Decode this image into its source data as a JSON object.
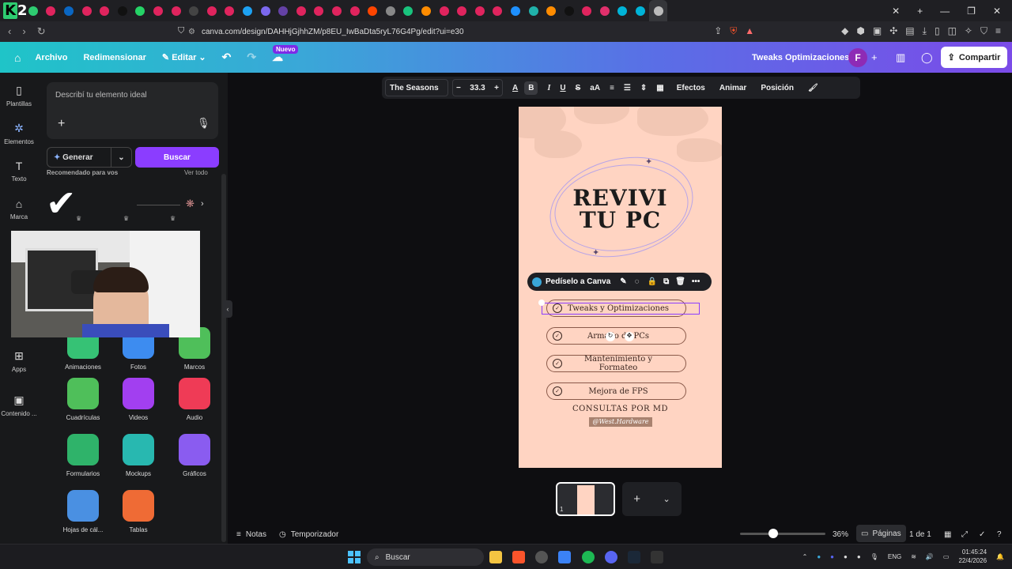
{
  "browser": {
    "url": "canva.com/design/DAHHjGjhhZM/p8EU_IwBaDta5ryL76G4Pg/edit?ui=e30",
    "tab_colors": [
      "#2ecc71",
      "#e0245e",
      "#0a66c2",
      "#e0245e",
      "#e0245e",
      "#111111",
      "#25d366",
      "#e0245e",
      "#e0245e",
      "#444444",
      "#e0245e",
      "#e0245e",
      "#1da1f2",
      "#7b68ee",
      "#6441a5",
      "#e0245e",
      "#e0245e",
      "#e0245e",
      "#e0245e",
      "#ff4500",
      "#888888",
      "#19c37d",
      "#ff8c00",
      "#e0245e",
      "#e0245e",
      "#e0245e",
      "#e0245e",
      "#1e90ff",
      "#20b2aa",
      "#ff8c00",
      "#111111",
      "#e0245e",
      "#e1306c",
      "#00b4d8",
      "#00b4d8",
      "#bbbbbb"
    ]
  },
  "canva_bar": {
    "file": "Archivo",
    "resize": "Redimensionar",
    "edit": "Editar",
    "new_badge": "Nuevo",
    "doc_title": "Tweaks Optimizaciones",
    "avatar_letter": "F",
    "share": "Compartir"
  },
  "left_nav": [
    {
      "label": "Plantillas",
      "icon": "template-icon"
    },
    {
      "label": "Elementos",
      "icon": "elements-icon"
    },
    {
      "label": "Texto",
      "icon": "text-icon"
    },
    {
      "label": "Marca",
      "icon": "brand-icon"
    },
    {
      "label": "Apps",
      "icon": "apps-icon"
    },
    {
      "label": "Contenido ...",
      "icon": "content-icon"
    }
  ],
  "panel": {
    "prompt_placeholder": "Describí tu elemento ideal",
    "generate": "Generar",
    "search": "Buscar",
    "recommended": "Recomendado para vos",
    "see_all": "Ver todo",
    "apps": [
      {
        "label": "Animaciones",
        "color": "#36c275"
      },
      {
        "label": "Fotos",
        "color": "#3d8cf0"
      },
      {
        "label": "Marcos",
        "color": "#4fbf5a"
      },
      {
        "label": "Cuadrículas",
        "color": "#4fbf5a"
      },
      {
        "label": "Videos",
        "color": "#a23ff0"
      },
      {
        "label": "Audio",
        "color": "#ef3b56"
      },
      {
        "label": "Formularios",
        "color": "#2fb36a"
      },
      {
        "label": "Mockups",
        "color": "#28b8b0"
      },
      {
        "label": "Gráficos",
        "color": "#8a5cf0"
      },
      {
        "label": "Hojas de cál...",
        "color": "#4a90e2"
      },
      {
        "label": "Tablas",
        "color": "#ef6b35"
      }
    ]
  },
  "text_toolbar": {
    "font": "The Seasons",
    "size": "33.3",
    "effects": "Efectos",
    "animate": "Animar",
    "position": "Posición"
  },
  "design": {
    "title_line1": "REVIVI",
    "title_line2": "TU PC",
    "ask_canva": "Pedíselo a Canva",
    "items": [
      "Tweaks y Optimizaciones",
      "Armado de PCs",
      "Mantenimiento y Formateo",
      "Mejora de FPS"
    ],
    "consult": "CONSULTAS POR MD",
    "handle": "@West.Hardware"
  },
  "footer": {
    "notes": "Notas",
    "timer": "Temporizador",
    "zoom": "36%",
    "zoom_fraction": 0.36,
    "pages": "Páginas",
    "page_count": "1 de 1",
    "thumb_number": "1"
  },
  "taskbar": {
    "search": "Buscar",
    "lang": "ENG",
    "time": "01:45:24",
    "date": "22/4/2026"
  }
}
